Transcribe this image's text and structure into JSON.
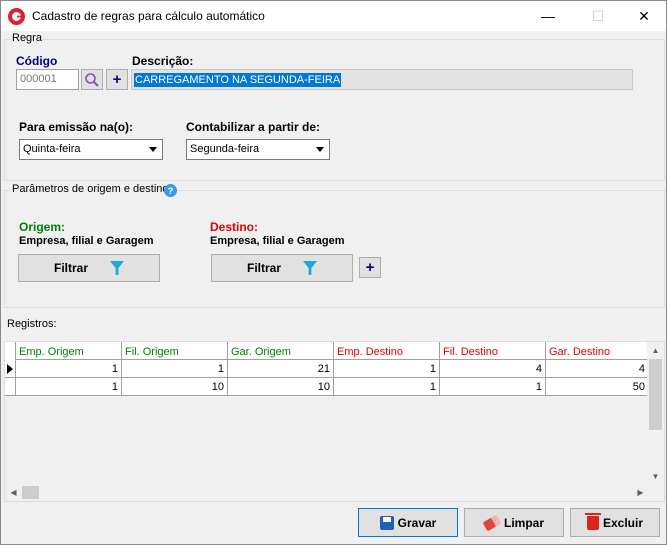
{
  "window": {
    "title": "Cadastro de regras para cálculo automático",
    "minimize": "—",
    "maximize": "☐",
    "close": "✕"
  },
  "regra": {
    "group_title": "Regra",
    "codigo_label": "Código",
    "codigo_value": "000001",
    "descricao_label": "Descrição:",
    "descricao_value": "CARREGAMENTO NA SEGUNDA-FEIRA",
    "add_symbol": "+",
    "emissao_label": "Para emissão na(o):",
    "emissao_value": "Quinta-feira",
    "contabilizar_label": "Contabilizar a partir de:",
    "contabilizar_value": "Segunda-feira"
  },
  "parametros": {
    "group_title": "Parâmetros de origem e destino",
    "help_symbol": "?",
    "origem_label": "Origem:",
    "origem_desc": "Empresa, filial e Garagem",
    "destino_label": "Destino:",
    "destino_desc": "Empresa, filial e Garagem",
    "filtrar_label": "Filtrar",
    "add_symbol": "+"
  },
  "registros": {
    "label": "Registros:",
    "columns": [
      "Emp. Origem",
      "Fil. Origem",
      "Gar. Origem",
      "Emp. Destino",
      "Fil. Destino",
      "Gar. Destino"
    ],
    "rows": [
      [
        "1",
        "1",
        "21",
        "1",
        "4",
        "4"
      ],
      [
        "1",
        "10",
        "10",
        "1",
        "1",
        "50"
      ]
    ]
  },
  "buttons": {
    "gravar": "Gravar",
    "limpar": "Limpar",
    "excluir": "Excluir"
  },
  "colors": {
    "accent": "#0078d7",
    "origem": "#008000",
    "destino": "#e00000",
    "label_navy": "#000080"
  }
}
